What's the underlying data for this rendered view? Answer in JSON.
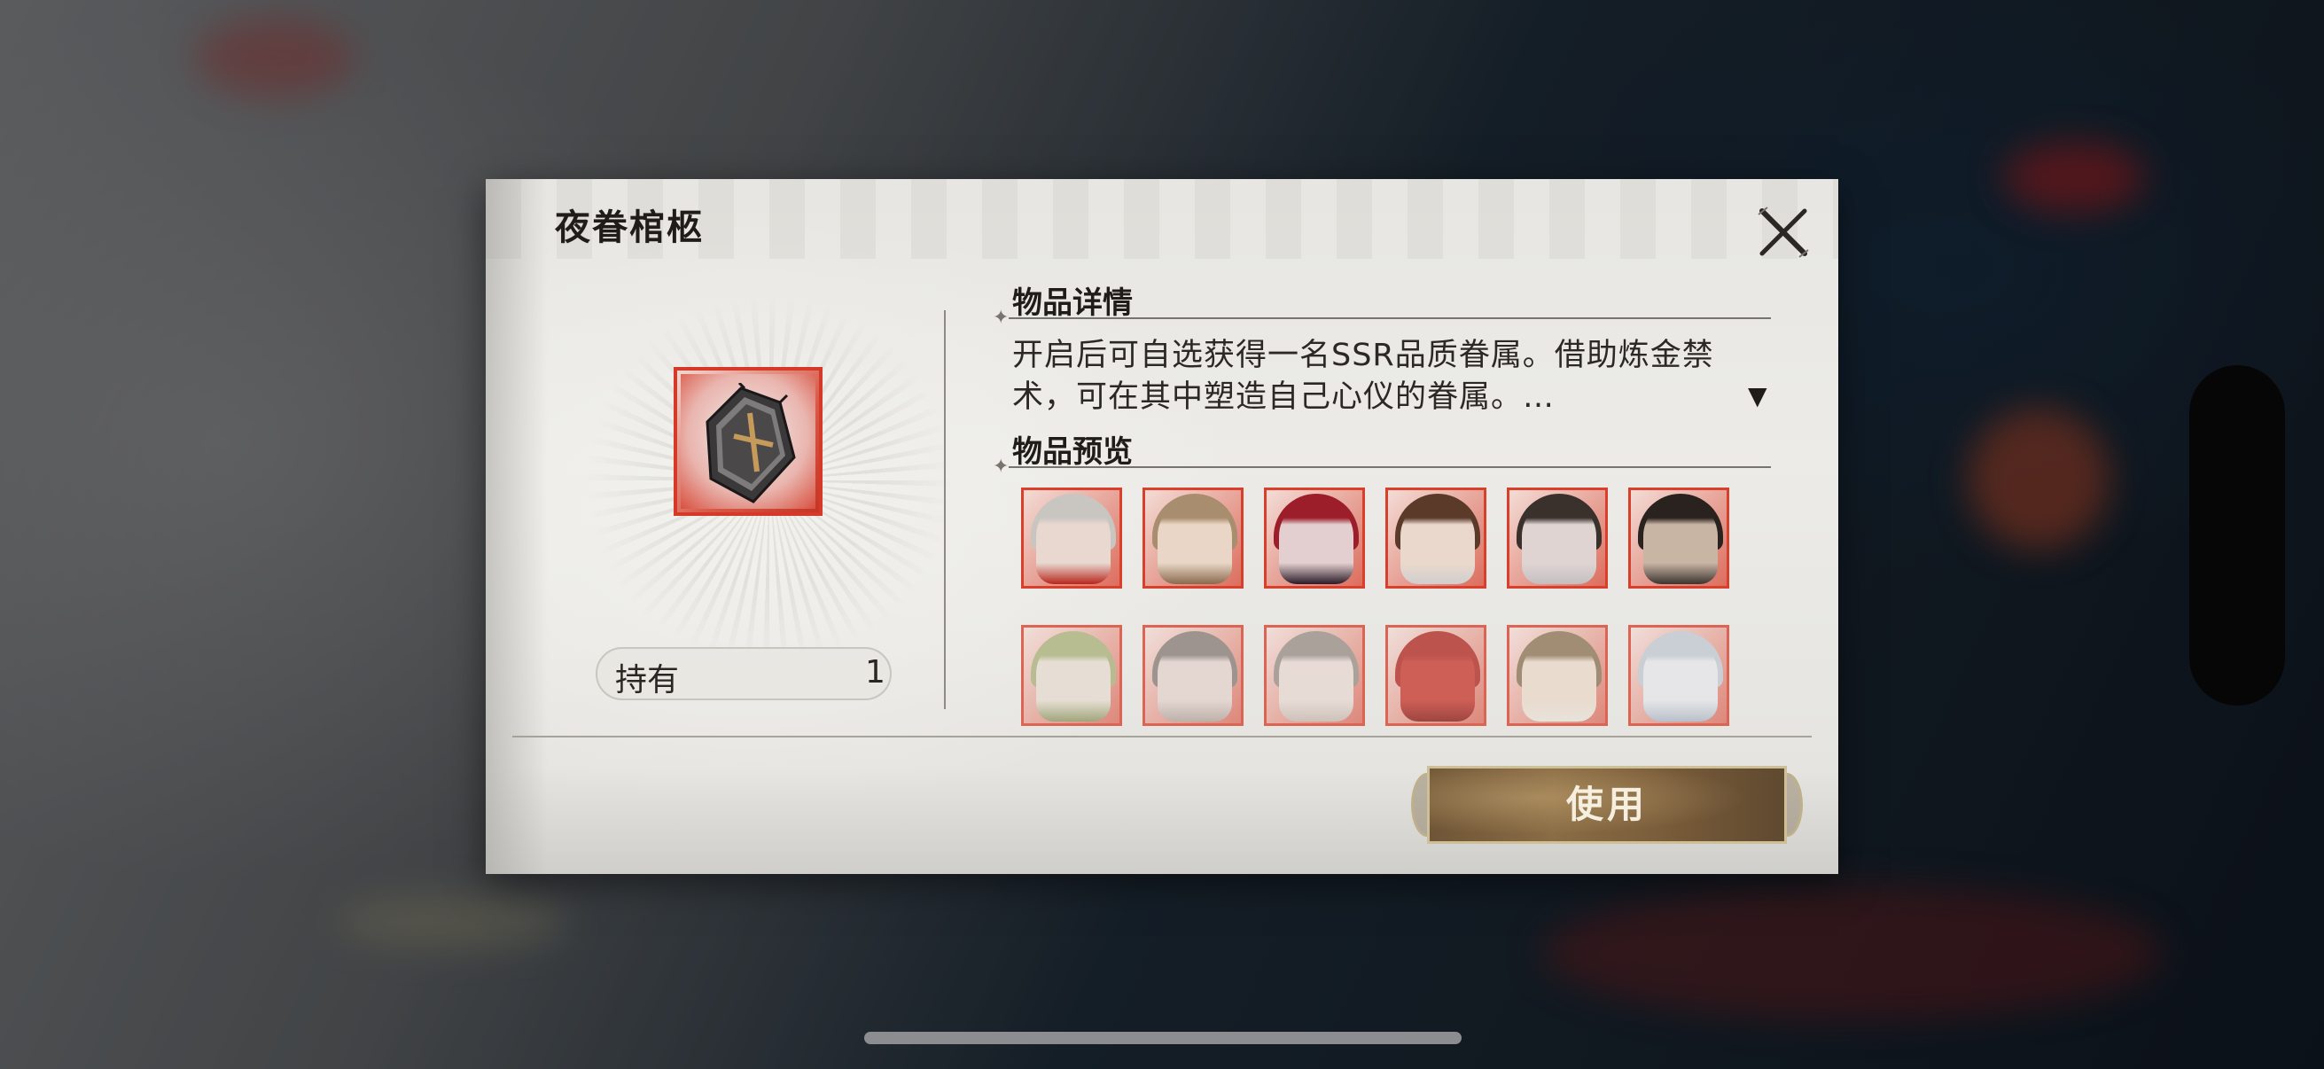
{
  "dialog": {
    "title": "夜眷棺柩",
    "close_icon": "close-x-icon"
  },
  "item": {
    "icon": "coffin-icon",
    "own_label": "持有",
    "own_count": "1"
  },
  "details": {
    "heading": "物品详情",
    "text": "开启后可自选获得一名SSR品质眷属。借助炼金禁术，可在其中塑造自己心仪的眷属。…",
    "expand_icon": "▼"
  },
  "preview": {
    "heading": "物品预览",
    "characters": [
      {
        "hair": "#c9c6c2",
        "skin": "#e8d8d0",
        "accent": "#b8261c"
      },
      {
        "hair": "#a88d6e",
        "skin": "#e9d6c6",
        "accent": "#8a6a4e"
      },
      {
        "hair": "#9c1e2a",
        "skin": "#e3cfcf",
        "accent": "#2a1a28"
      },
      {
        "hair": "#5b3a2a",
        "skin": "#ead8cc",
        "accent": "#d0cfcf"
      },
      {
        "hair": "#3a302c",
        "skin": "#dfd4d2",
        "accent": "#c4c0c0"
      },
      {
        "hair": "#2a221e",
        "skin": "#c9b5a4",
        "accent": "#3b3430"
      },
      {
        "hair": "#a9b07a",
        "skin": "#e6dcd0",
        "accent": "#8e9460"
      },
      {
        "hair": "#8a7e78",
        "skin": "#e4d2cc",
        "accent": "#b2a49c"
      },
      {
        "hair": "#9a8e88",
        "skin": "#e8d8d2",
        "accent": "#c7b8b0"
      },
      {
        "hair": "#b02a22",
        "skin": "#c63a30",
        "accent": "#8a1a14"
      },
      {
        "hair": "#8d7456",
        "skin": "#ead8c8",
        "accent": "#e8e2da"
      },
      {
        "hair": "#c2c8d2",
        "skin": "#e6e6ea",
        "accent": "#aeb6c4"
      }
    ]
  },
  "actions": {
    "use_label": "使用"
  },
  "colors": {
    "frame_red": "#d53a28",
    "button_gold": "#7a5d3a",
    "panel_bg": "#e7e6e2"
  }
}
